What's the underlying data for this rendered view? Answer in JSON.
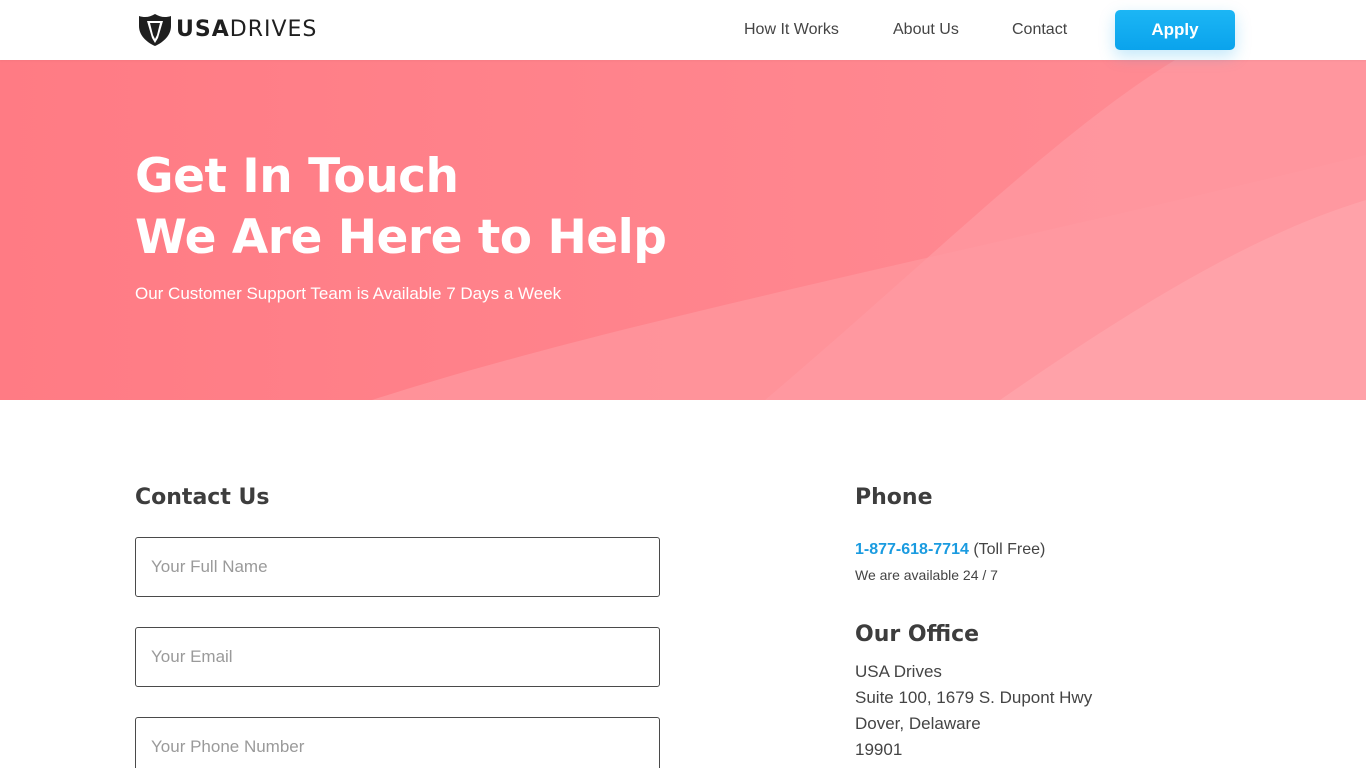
{
  "brand": {
    "logo_bold": "USA",
    "logo_light": "DRIVES"
  },
  "nav": {
    "how_it_works": "How It Works",
    "about_us": "About Us",
    "contact": "Contact",
    "apply": "Apply"
  },
  "hero": {
    "title_line1": "Get In Touch",
    "title_line2": "We Are Here to Help",
    "subtitle": "Our Customer Support Team is Available 7 Days a Week"
  },
  "contact_form": {
    "heading": "Contact Us",
    "name_placeholder": "Your Full Name",
    "email_placeholder": "Your Email",
    "phone_placeholder": "Your Phone Number"
  },
  "phone": {
    "heading": "Phone",
    "number": "1-877-618-7714",
    "note": "(Toll Free)",
    "availability": "We are available 24 / 7"
  },
  "office": {
    "heading": "Our Office",
    "line1": "USA Drives",
    "line2": "Suite 100, 1679 S. Dupont Hwy",
    "line3": "Dover, Delaware",
    "line4": "19901"
  },
  "colors": {
    "hero_base": "#ff7e86",
    "hero_light": "#ffa3aa",
    "accent_blue": "#1a9be0",
    "apply_button": "#0aa3ec"
  },
  "icons": {
    "logo": "shield-logo-icon"
  }
}
